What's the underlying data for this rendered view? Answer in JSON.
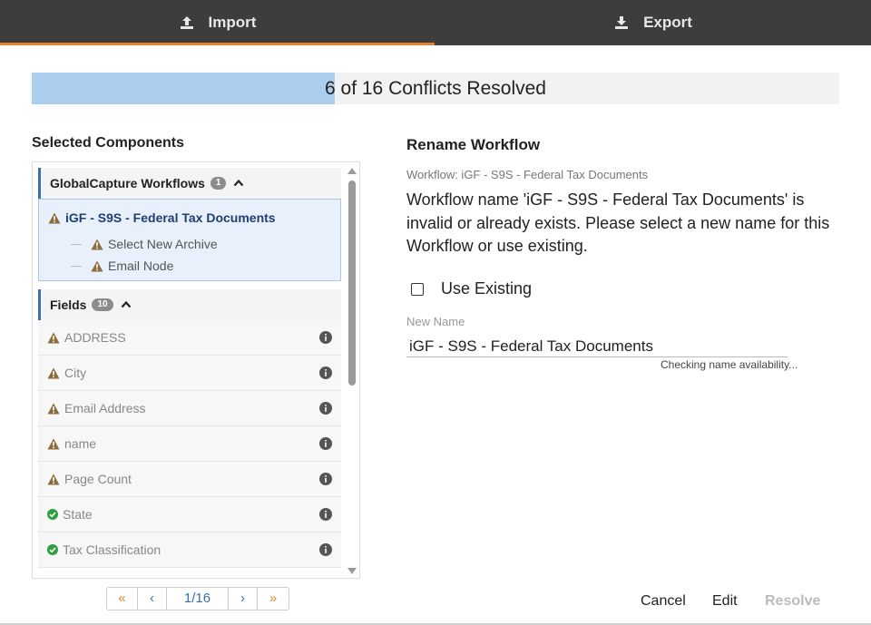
{
  "tabs": [
    {
      "label": "Import",
      "icon": "upload-icon",
      "active": true
    },
    {
      "label": "Export",
      "icon": "download-icon",
      "active": false
    }
  ],
  "progress": {
    "resolved": 6,
    "total": 16,
    "text": "6 of 16 Conflicts Resolved"
  },
  "selected_components": {
    "title": "Selected Components",
    "workflows": {
      "label": "GlobalCapture Workflows",
      "count": "1",
      "items": [
        {
          "label": "iGF - S9S - Federal Tax Documents",
          "status": "warning",
          "children": [
            {
              "label": "Select New Archive",
              "status": "warning"
            },
            {
              "label": "Email Node",
              "status": "warning"
            }
          ]
        }
      ]
    },
    "fields": {
      "label": "Fields",
      "count": "10",
      "items": [
        {
          "label": "ADDRESS",
          "status": "warning"
        },
        {
          "label": "City",
          "status": "warning"
        },
        {
          "label": "Email Address",
          "status": "warning"
        },
        {
          "label": "name",
          "status": "warning"
        },
        {
          "label": "Page Count",
          "status": "warning"
        },
        {
          "label": "State",
          "status": "ok"
        },
        {
          "label": "Tax Classification",
          "status": "ok"
        }
      ]
    }
  },
  "pager": {
    "first": "«",
    "prev": "‹",
    "page": "1/16",
    "next": "›",
    "last": "»"
  },
  "rename": {
    "title": "Rename Workflow",
    "workflow_label": "Workflow: iGF - S9S - Federal Tax Documents",
    "message": "Workflow name 'iGF - S9S - Federal Tax Documents' is invalid or already exists. Please select a new name for this Workflow or use existing.",
    "use_existing_label": "Use Existing",
    "new_name_label": "New Name",
    "new_name_value": "iGF - S9S - Federal Tax Documents",
    "checking_text": "Checking name availability..."
  },
  "actions": {
    "cancel": "Cancel",
    "edit": "Edit",
    "resolve": "Resolve"
  },
  "colors": {
    "topbar": "#3d3d3d",
    "accent": "#e8822c",
    "progress_fill": "#abcdee",
    "selection": "#e7f0fb",
    "warning": "#8a6d3b",
    "ok": "#2ea043",
    "link": "#3b6fae"
  }
}
